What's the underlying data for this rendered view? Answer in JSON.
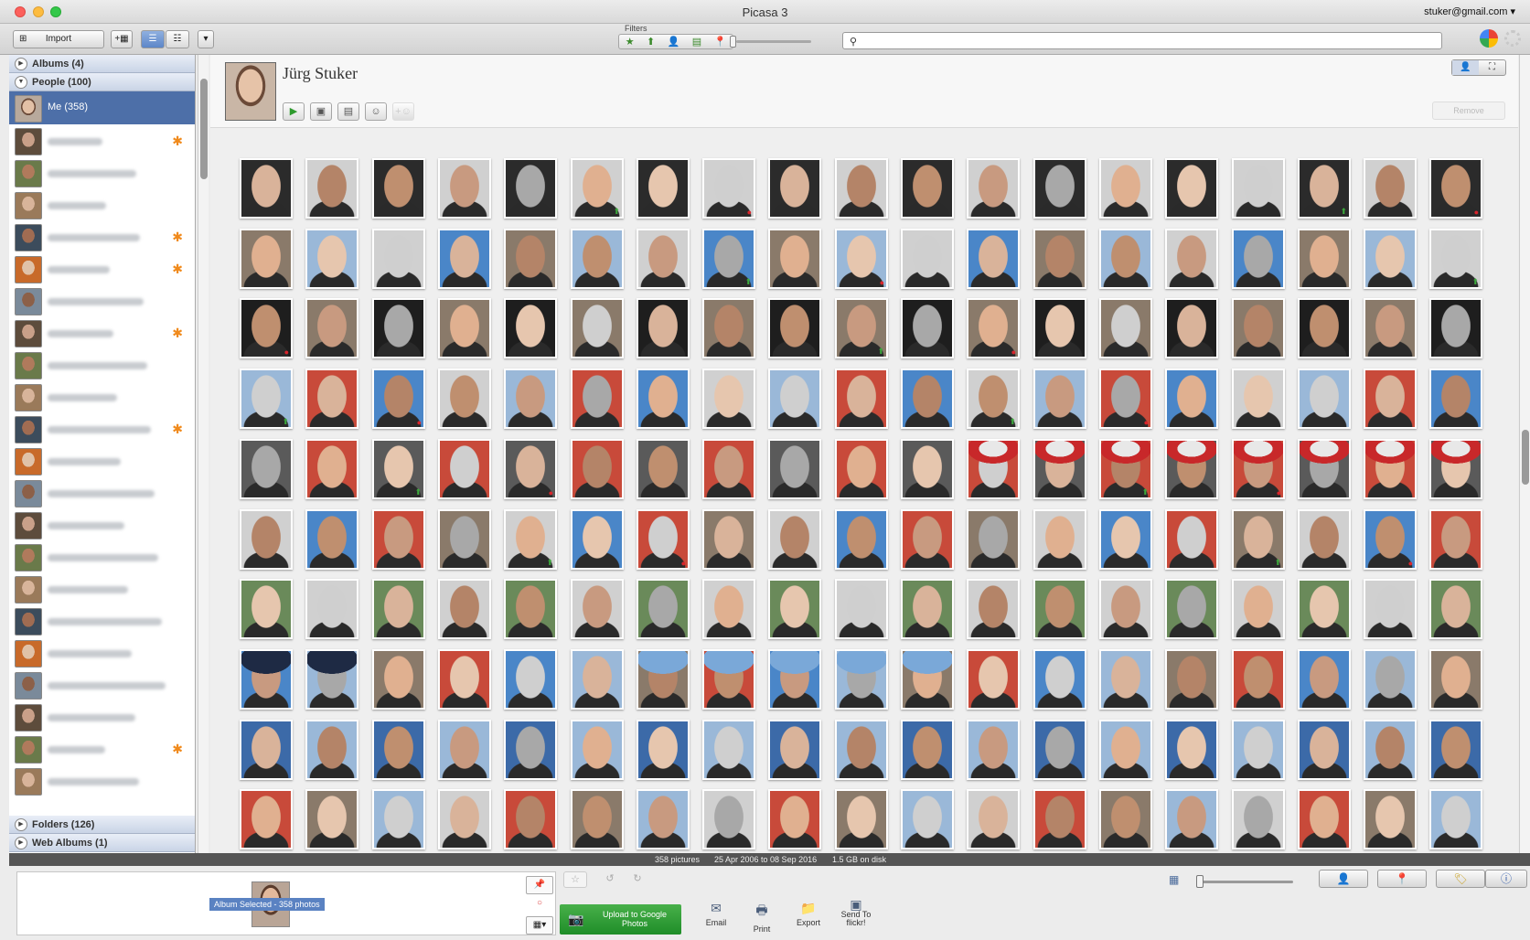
{
  "window": {
    "title": "Picasa 3",
    "account": "stuker@gmail.com ▾"
  },
  "toolbar": {
    "import_label": "Import",
    "filters_label": "Filters",
    "filter_icons": [
      "★",
      "⬆",
      "👤",
      "▤",
      "📍"
    ],
    "search_placeholder": ""
  },
  "sidebar": {
    "albums_header": "Albums (4)",
    "people_header": "People (100)",
    "selected_label": "Me (358)",
    "folders_header": "Folders (126)",
    "web_albums_header": "Web Albums (1)"
  },
  "person": {
    "name": "Jürg Stuker",
    "remove_label": "Remove"
  },
  "status": {
    "pictures": "358 pictures",
    "date_range": "25 Apr 2006 to 08 Sep 2016",
    "disk": "1.5 GB on disk"
  },
  "tray": {
    "selection_tag": "Album Selected - 358 photos",
    "upload_label": "Upload to Google Photos",
    "share_buttons": [
      {
        "label": "Email",
        "icon": "✉"
      },
      {
        "label": "Print",
        "icon": "🖶"
      },
      {
        "label": "Export",
        "icon": "📁"
      },
      {
        "label": "Send To flickr!",
        "icon": "▣"
      }
    ]
  },
  "colors": {
    "accent": "#4d6fa8",
    "upload": "#2f9e34",
    "badge": "#f08a1c"
  }
}
